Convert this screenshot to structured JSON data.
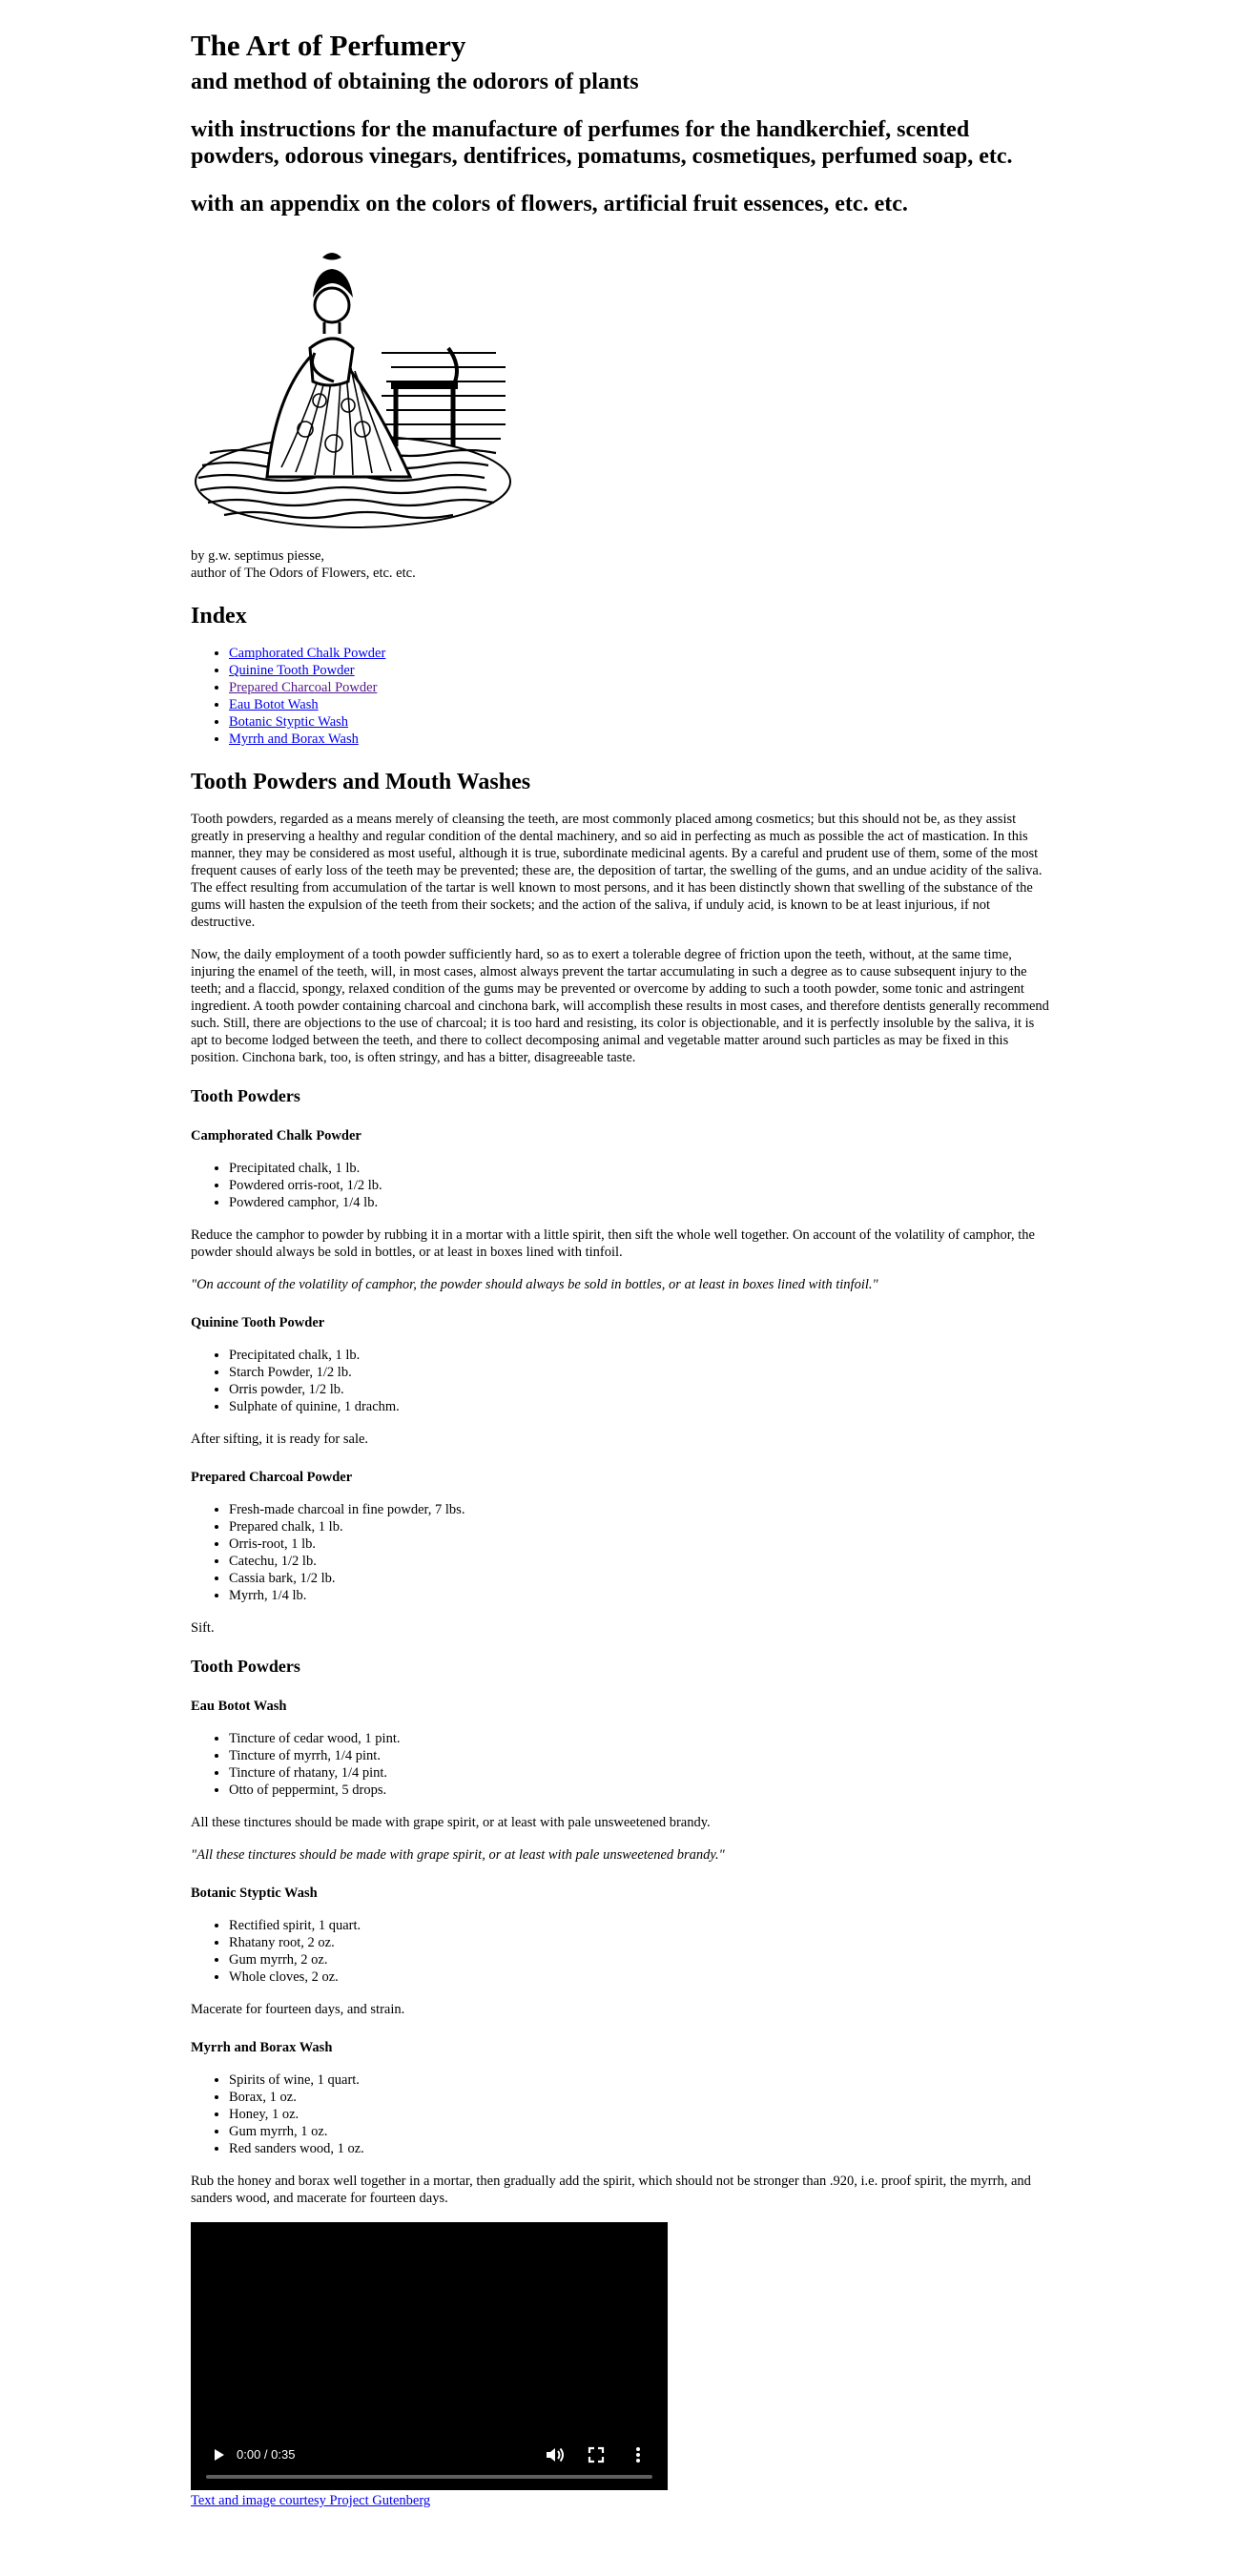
{
  "header": {
    "title": "The Art of Perfumery",
    "subtitle1": "and method of obtaining the odorors of plants",
    "subtitle2": "with instructions for the manufacture of perfumes for the handkerchief, scented powders, odorous vinegars, dentifrices, pomatums, cosmetiques, perfumed soap, etc.",
    "subtitle3": "with an appendix on the colors of flowers, artificial fruit essences, etc. etc."
  },
  "byline": {
    "line1": "by g.w. septimus piesse,",
    "line2": "author of The Odors of Flowers, etc. etc."
  },
  "index": {
    "heading": "Index",
    "links": [
      "Camphorated Chalk Powder",
      "Quinine Tooth Powder",
      "Prepared Charcoal Powder",
      "Eau Botot Wash",
      "Botanic Styptic Wash",
      "Myrrh and Borax Wash"
    ]
  },
  "main": {
    "heading": "Tooth Powders and Mouth Washes",
    "intro1": "Tooth powders, regarded as a means merely of cleansing the teeth, are most commonly placed among cosmetics; but this should not be, as they assist greatly in preserving a healthy and regular condition of the dental machinery, and so aid in perfecting as much as possible the act of mastication. In this manner, they may be considered as most useful, although it is true, subordinate medicinal agents. By a careful and prudent use of them, some of the most frequent causes of early loss of the teeth may be prevented; these are, the deposition of tartar, the swelling of the gums, and an undue acidity of the saliva. The effect resulting from accumulation of the tartar is well known to most persons, and it has been distinctly shown that swelling of the substance of the gums will hasten the expulsion of the teeth from their sockets; and the action of the saliva, if unduly acid, is known to be at least injurious, if not destructive.",
    "intro2": "Now, the daily employment of a tooth powder sufficiently hard, so as to exert a tolerable degree of friction upon the teeth, without, at the same time, injuring the enamel of the teeth, will, in most cases, almost always prevent the tartar accumulating in such a degree as to cause subsequent injury to the teeth; and a flaccid, spongy, relaxed condition of the gums may be prevented or overcome by adding to such a tooth powder, some tonic and astringent ingredient. A tooth powder containing charcoal and cinchona bark, will accomplish these results in most cases, and therefore dentists generally recommend such. Still, there are objections to the use of charcoal; it is too hard and resisting, its color is objectionable, and it is perfectly insoluble by the saliva, it is apt to become lodged between the teeth, and there to collect decomposing animal and vegetable matter around such particles as may be fixed in this position. Cinchona bark, too, is often stringy, and has a bitter, disagreeable taste."
  },
  "section1": {
    "heading": "Tooth Powders",
    "recipes": [
      {
        "name": "Camphorated Chalk Powder",
        "items": [
          "Precipitated chalk, 1 lb.",
          "Powdered orris-root, 1/2 lb.",
          "Powdered camphor, 1/4 lb."
        ],
        "text": "Reduce the camphor to powder by rubbing it in a mortar with a little spirit, then sift the whole well together. On account of the volatility of camphor, the powder should always be sold in bottles, or at least in boxes lined with tinfoil.",
        "quote": "\"On account of the volatility of camphor, the powder should always be sold in bottles, or at least in boxes lined with tinfoil.\""
      },
      {
        "name": "Quinine Tooth Powder",
        "items": [
          "Precipitated chalk, 1 lb.",
          "Starch Powder, 1/2 lb.",
          "Orris powder, 1/2 lb.",
          "Sulphate of quinine, 1 drachm."
        ],
        "text": "After sifting, it is ready for sale."
      },
      {
        "name": "Prepared Charcoal Powder",
        "items": [
          "Fresh-made charcoal in fine powder, 7 lbs.",
          "Prepared chalk, 1 lb.",
          "Orris-root, 1 lb.",
          "Catechu, 1/2 lb.",
          "Cassia bark, 1/2 lb.",
          "Myrrh, 1/4 lb."
        ],
        "text": "Sift."
      }
    ]
  },
  "section2": {
    "heading": "Tooth Powders",
    "recipes": [
      {
        "name": "Eau Botot Wash",
        "items": [
          "Tincture of cedar wood, 1 pint.",
          "Tincture of myrrh, 1/4 pint.",
          "Tincture of rhatany, 1/4 pint.",
          "Otto of peppermint, 5 drops."
        ],
        "text": "All these tinctures should be made with grape spirit, or at least with pale unsweetened brandy.",
        "quote": "\"All these tinctures should be made with grape spirit, or at least with pale unsweetened brandy.\""
      },
      {
        "name": "Botanic Styptic Wash",
        "items": [
          "Rectified spirit, 1 quart.",
          "Rhatany root, 2 oz.",
          "Gum myrrh, 2 oz.",
          "Whole cloves, 2 oz."
        ],
        "text": "Macerate for fourteen days, and strain."
      },
      {
        "name": "Myrrh and Borax Wash",
        "items": [
          "Spirits of wine, 1 quart.",
          "Borax, 1 oz.",
          "Honey, 1 oz.",
          "Gum myrrh, 1 oz.",
          "Red sanders wood, 1 oz."
        ],
        "text": "Rub the honey and borax well together in a mortar, then gradually add the spirit, which should not be stronger than .920, i.e. proof spirit, the myrrh, and sanders wood, and macerate for fourteen days."
      }
    ]
  },
  "video": {
    "time": "0:00 / 0:35"
  },
  "credit": "Text and image courtesy Project Gutenberg"
}
